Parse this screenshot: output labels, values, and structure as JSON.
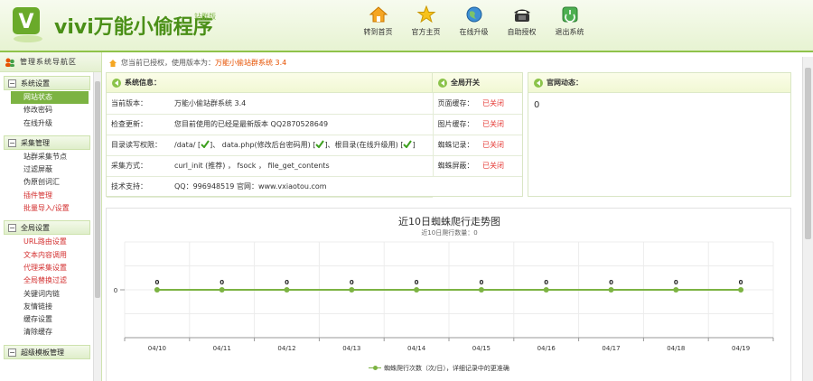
{
  "header": {
    "app_title": "vivi万能小偷程序",
    "app_sub": "站群版",
    "nav": [
      {
        "label": "转到首页",
        "icon": "home-icon"
      },
      {
        "label": "官方主页",
        "icon": "star-icon"
      },
      {
        "label": "在线升级",
        "icon": "globe-icon"
      },
      {
        "label": "自助授权",
        "icon": "phone-icon"
      },
      {
        "label": "退出系统",
        "icon": "exit-icon"
      }
    ]
  },
  "sidebar": {
    "title": "管理系统导航区",
    "groups": [
      {
        "title": "系统设置",
        "items": [
          {
            "label": "网站状态",
            "active": true
          },
          {
            "label": "修改密码"
          },
          {
            "label": "在线升级"
          }
        ]
      },
      {
        "title": "采集管理",
        "items": [
          {
            "label": "站群采集节点"
          },
          {
            "label": "过滤屏蔽"
          },
          {
            "label": "伪原创词汇"
          },
          {
            "label": "插件管理",
            "red": true
          },
          {
            "label": "批量导入/设置",
            "red": true
          }
        ]
      },
      {
        "title": "全局设置",
        "items": [
          {
            "label": "URL路由设置",
            "red": true
          },
          {
            "label": "文本内容调用",
            "red": true
          },
          {
            "label": "代理采集设置",
            "red": true
          },
          {
            "label": "全局替换过滤",
            "red": true
          },
          {
            "label": "关键词内链"
          },
          {
            "label": "友情链接"
          },
          {
            "label": "缓存设置"
          },
          {
            "label": "清除缓存"
          }
        ]
      },
      {
        "title": "超级模板管理",
        "items": []
      }
    ]
  },
  "breadcrumb": {
    "prefix": "您当前已授权，使用版本为：",
    "version": "万能小偷站群系统 3.4"
  },
  "system_info": {
    "title": "系统信息：",
    "switch_title": "全局开关",
    "rows": [
      {
        "key": "当前版本：",
        "value": "万能小偷站群系统 3.4",
        "switch_key": "页面缓存：",
        "switch_val": "已关闭"
      },
      {
        "key": "检查更新：",
        "value": "您目前使用的已经是最新版本 QQ2870528649",
        "switch_key": "图片缓存：",
        "switch_val": "已关闭"
      },
      {
        "key": "目录读写权限：",
        "value_a": "/data/ [",
        "value_b": "]、 data.php(修改后台密码用) [",
        "value_c": "]、根目录(在线升级用) [",
        "value_d": "]",
        "switch_key": "蜘蛛记录：",
        "switch_val": "已关闭"
      },
      {
        "key": "采集方式：",
        "value": "curl_init (推荐) ， fsock ， file_get_contents",
        "switch_key": "蜘蛛屏蔽：",
        "switch_val": "已关闭"
      },
      {
        "key": "技术支持：",
        "value": "QQ：996948519    官网：www.vxiaotou.com"
      }
    ]
  },
  "news": {
    "title": "官网动态：",
    "value": "0"
  },
  "colors": {
    "accent": "#7cb342",
    "off": "#e53935",
    "header_bg": "#e7f3d2"
  },
  "chart_data": {
    "type": "line",
    "title": "近10日蜘蛛爬行走势图",
    "subtitle": "近10日爬行数量：0",
    "categories": [
      "04/10",
      "04/11",
      "04/12",
      "04/13",
      "04/14",
      "04/15",
      "04/16",
      "04/17",
      "04/18",
      "04/19"
    ],
    "series": [
      {
        "name": "蜘蛛爬行次数（次/日），详细记录中的更准确",
        "values": [
          0,
          0,
          0,
          0,
          0,
          0,
          0,
          0,
          0,
          0
        ]
      }
    ],
    "yticks": [
      "0"
    ],
    "ylim": [
      -1,
      1
    ],
    "grid": true,
    "legend": "bottom"
  }
}
